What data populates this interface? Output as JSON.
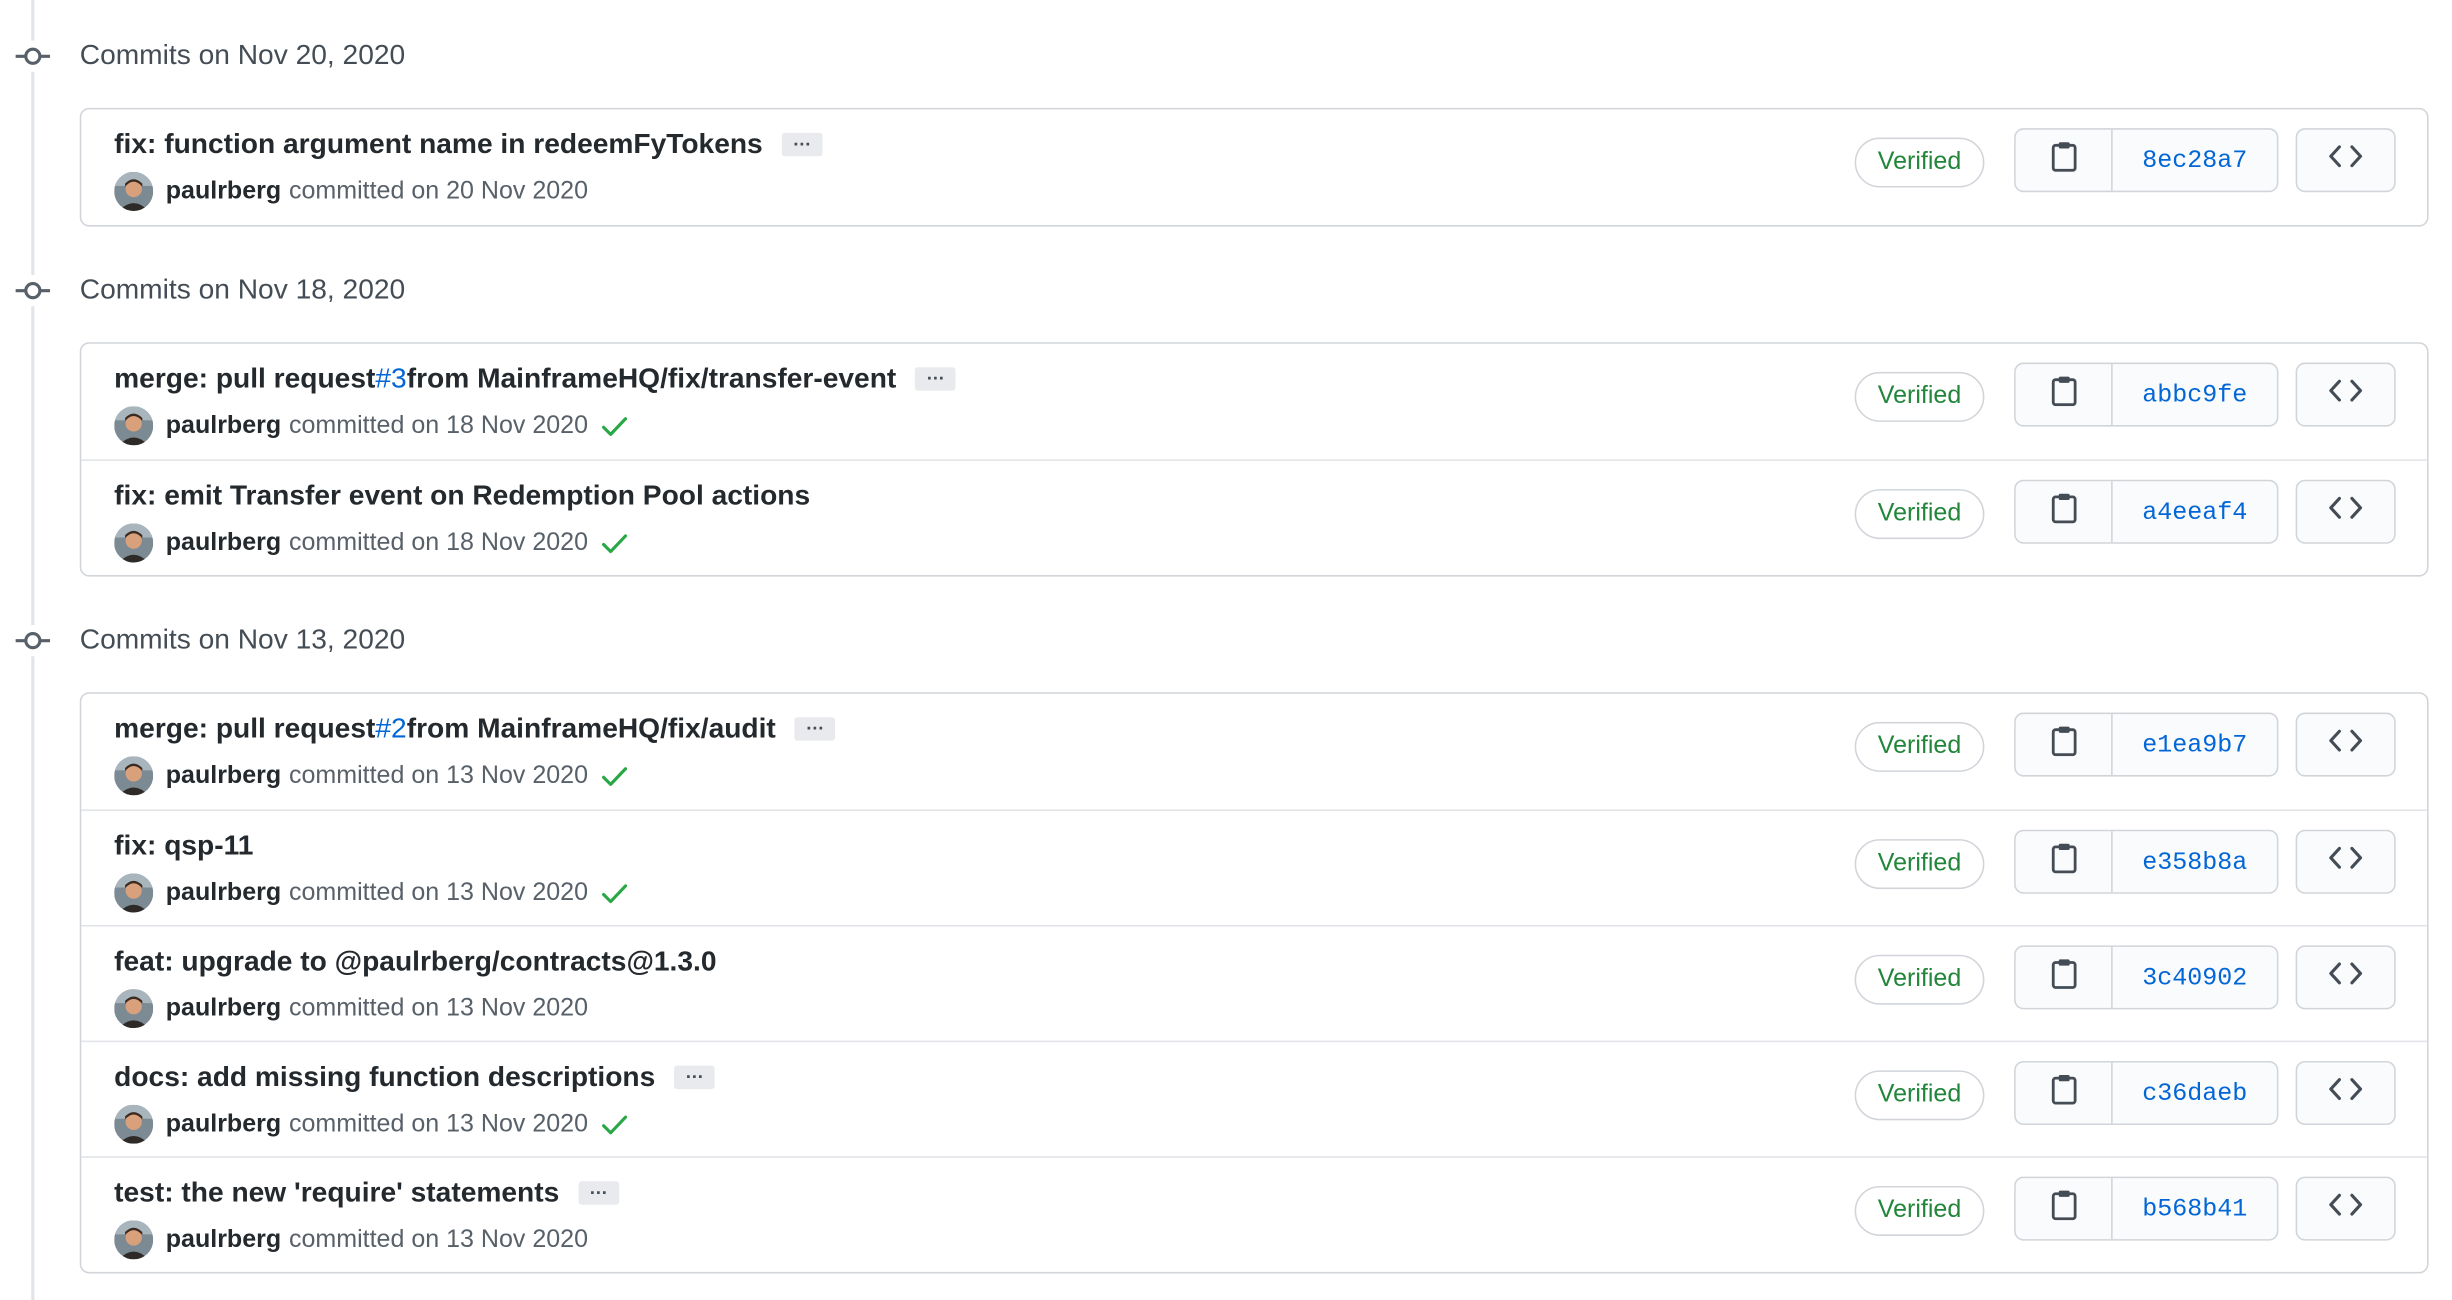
{
  "groups": [
    {
      "title": "Commits on Nov 20, 2020",
      "commits": [
        {
          "title_pre": "fix: function argument name in redeemFyTokens",
          "pr": "",
          "title_post": "",
          "has_ellipsis": true,
          "author": "paulrberg",
          "date_text": "committed on 20 Nov 2020",
          "checked": false,
          "verified": "Verified",
          "sha": "8ec28a7"
        }
      ]
    },
    {
      "title": "Commits on Nov 18, 2020",
      "commits": [
        {
          "title_pre": "merge: pull request ",
          "pr": "#3",
          "title_post": " from MainframeHQ/fix/transfer-event",
          "has_ellipsis": true,
          "author": "paulrberg",
          "date_text": "committed on 18 Nov 2020",
          "checked": true,
          "verified": "Verified",
          "sha": "abbc9fe"
        },
        {
          "title_pre": "fix: emit Transfer event on Redemption Pool actions",
          "pr": "",
          "title_post": "",
          "has_ellipsis": false,
          "author": "paulrberg",
          "date_text": "committed on 18 Nov 2020",
          "checked": true,
          "verified": "Verified",
          "sha": "a4eeaf4"
        }
      ]
    },
    {
      "title": "Commits on Nov 13, 2020",
      "commits": [
        {
          "title_pre": "merge: pull request ",
          "pr": "#2",
          "title_post": " from MainframeHQ/fix/audit",
          "has_ellipsis": true,
          "author": "paulrberg",
          "date_text": "committed on 13 Nov 2020",
          "checked": true,
          "verified": "Verified",
          "sha": "e1ea9b7"
        },
        {
          "title_pre": "fix: qsp-11",
          "pr": "",
          "title_post": "",
          "has_ellipsis": false,
          "author": "paulrberg",
          "date_text": "committed on 13 Nov 2020",
          "checked": true,
          "verified": "Verified",
          "sha": "e358b8a"
        },
        {
          "title_pre": "feat: upgrade to @paulrberg/contracts@1.3.0",
          "pr": "",
          "title_post": "",
          "has_ellipsis": false,
          "author": "paulrberg",
          "date_text": "committed on 13 Nov 2020",
          "checked": false,
          "verified": "Verified",
          "sha": "3c40902"
        },
        {
          "title_pre": "docs: add missing function descriptions",
          "pr": "",
          "title_post": "",
          "has_ellipsis": true,
          "author": "paulrberg",
          "date_text": "committed on 13 Nov 2020",
          "checked": true,
          "verified": "Verified",
          "sha": "c36daeb"
        },
        {
          "title_pre": "test: the new 'require' statements",
          "pr": "",
          "title_post": "",
          "has_ellipsis": true,
          "author": "paulrberg",
          "date_text": "committed on 13 Nov 2020",
          "checked": false,
          "verified": "Verified",
          "sha": "b568b41"
        }
      ]
    }
  ],
  "ellipsis_label": "…",
  "colors": {
    "verified": "#22863a",
    "sha_link": "#0366d6",
    "check": "#28a745"
  }
}
